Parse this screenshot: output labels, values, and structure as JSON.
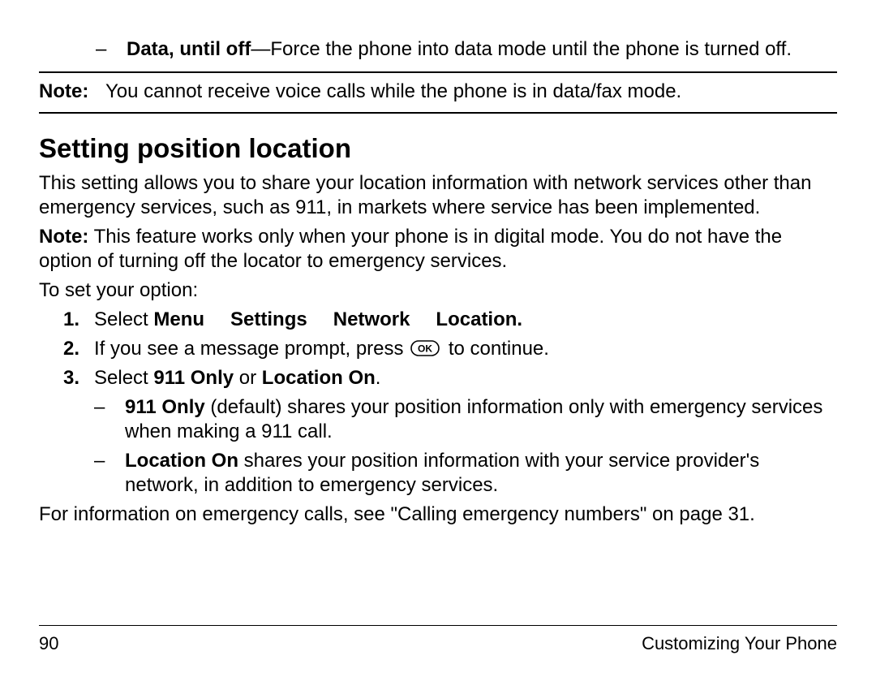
{
  "top_bullet": {
    "dash": "–",
    "bold": "Data, until off",
    "text": "—Force the phone into data mode until the phone is turned off."
  },
  "note1": {
    "label": "Note:",
    "text": "You cannot receive voice calls while the phone is in data/fax mode."
  },
  "heading": "Setting position location",
  "intro": "This setting allows you to share your location information with network services other than emergency services, such as 911, in markets where service has been implemented.",
  "note2": {
    "label": "Note:",
    "text": " This feature works only when your phone is in digital mode. You do not have the option of turning off the locator to emergency services."
  },
  "toset": "To set your option:",
  "step1": {
    "num": "1.",
    "prefix": "Select ",
    "path": [
      "Menu",
      "Settings",
      "Network",
      "Location."
    ]
  },
  "step2": {
    "num": "2.",
    "before": "If you see a message prompt, press ",
    "after": " to continue."
  },
  "step3": {
    "num": "3.",
    "prefix": "Select ",
    "bold1": "911 Only",
    "mid": " or ",
    "bold2": "Location On",
    "suffix": "."
  },
  "sub1": {
    "dash": "–",
    "bold": "911 Only",
    "text": " (default) shares your position information only with emergency services when making a 911 call."
  },
  "sub2": {
    "dash": "–",
    "bold": "Location On",
    "text": " shares your position information with your service provider's network, in addition to emergency services."
  },
  "outro": "For information on emergency calls, see \"Calling emergency numbers\" on page 31.",
  "footer": {
    "page": "90",
    "section": "Customizing Your Phone"
  },
  "ok_label": "OK"
}
